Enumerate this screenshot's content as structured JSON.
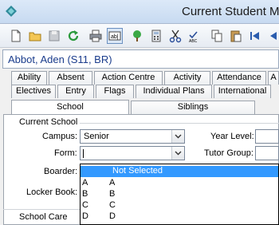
{
  "window": {
    "title": "Current Student Ma"
  },
  "toolbar": {
    "icons": [
      "new-document-icon",
      "open-folder-icon",
      "save-icon",
      "refresh-icon",
      "print-icon",
      "field-text-icon",
      "tree-icon",
      "calculator-icon",
      "cut-icon",
      "spellcheck-icon",
      "copy-icon",
      "paste-icon",
      "first-record-icon",
      "previous-record-icon"
    ]
  },
  "student": {
    "name": "Abbot, Aden (S11, BR)"
  },
  "tabs": {
    "row1": [
      "Ability",
      "Absent",
      "Action Centre",
      "Activity",
      "Attendance",
      "A"
    ],
    "row2": [
      "Electives",
      "Entry",
      "Flags",
      "Individual Plans",
      "International"
    ],
    "row3": [
      "School",
      "Siblings"
    ]
  },
  "form": {
    "group_current_school": "Current School",
    "campus_label": "Campus:",
    "campus_value": "Senior",
    "year_level_label": "Year Level:",
    "form_label": "Form:",
    "form_value": "",
    "tutor_group_label": "Tutor Group:",
    "boarder_label": "Boarder:",
    "locker_book_label": "Locker Book:",
    "group_school_care": "School Care"
  },
  "dropdown": {
    "selected": "Not Selected",
    "options": [
      {
        "code": "A",
        "desc": "A"
      },
      {
        "code": "B",
        "desc": "B"
      },
      {
        "code": "C",
        "desc": "C"
      },
      {
        "code": "D",
        "desc": "D"
      }
    ]
  },
  "colors": {
    "selection": "#3399ff",
    "student_name": "#1a3c8c"
  }
}
